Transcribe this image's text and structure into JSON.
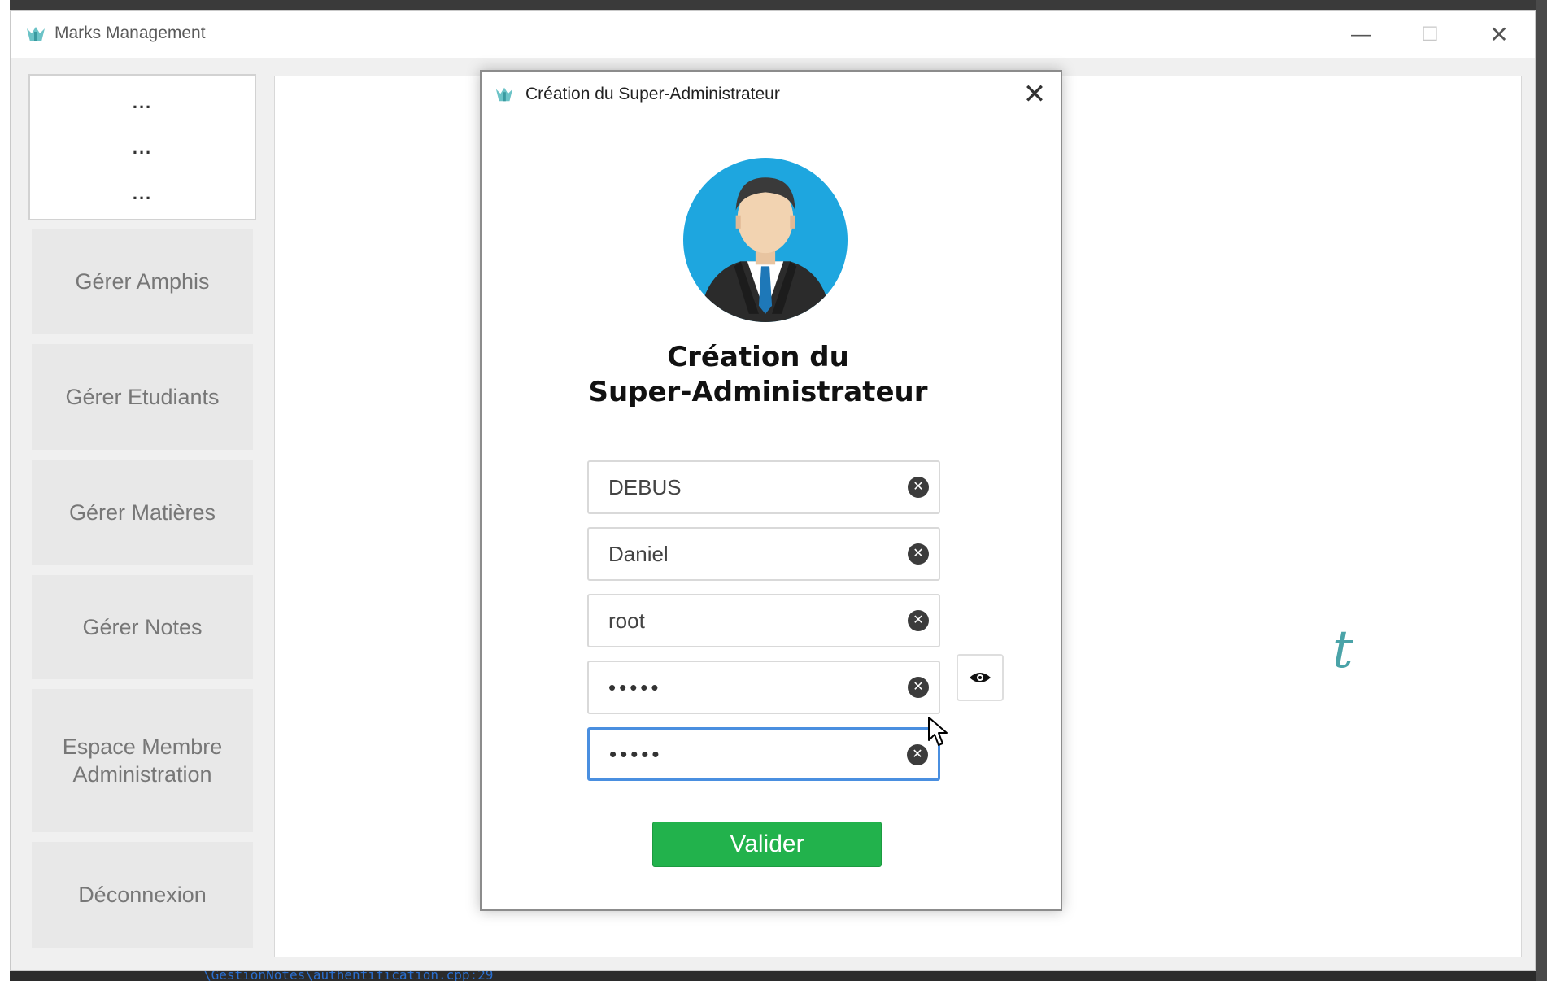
{
  "window": {
    "title": "Marks Management",
    "controls": {
      "minimize": "—",
      "maximize": "☐",
      "close": "✕"
    }
  },
  "sidebar": {
    "placeholder_lines": [
      "...",
      "...",
      "..."
    ],
    "items": [
      {
        "label": "Gérer Amphis"
      },
      {
        "label": "Gérer Etudiants"
      },
      {
        "label": "Gérer Matières"
      },
      {
        "label": "Gérer Notes"
      },
      {
        "label": "Espace Membre Administration"
      },
      {
        "label": "Déconnexion"
      }
    ]
  },
  "content": {
    "background_glyph": "t"
  },
  "dialog": {
    "title": "Création du Super-Administrateur",
    "close": "✕",
    "heading_line1": "Création du",
    "heading_line2": "Super-Administrateur",
    "fields": [
      {
        "value": "DEBUS"
      },
      {
        "value": "Daniel"
      },
      {
        "value": "root"
      },
      {
        "value": "•••••"
      },
      {
        "value": "•••••"
      }
    ],
    "clear_glyph": "✕",
    "submit_label": "Valider"
  },
  "ide": {
    "bottom_path": "\\GestionNotes\\authentification.cpp:29"
  },
  "colors": {
    "accent_green": "#22b24c",
    "focus_blue": "#4a8fe0",
    "avatar_bg": "#1ea6df"
  },
  "icons": [
    "app-logo-icon",
    "close-icon",
    "clear-icon",
    "eye-icon",
    "user-avatar-icon",
    "mouse-cursor-icon"
  ]
}
